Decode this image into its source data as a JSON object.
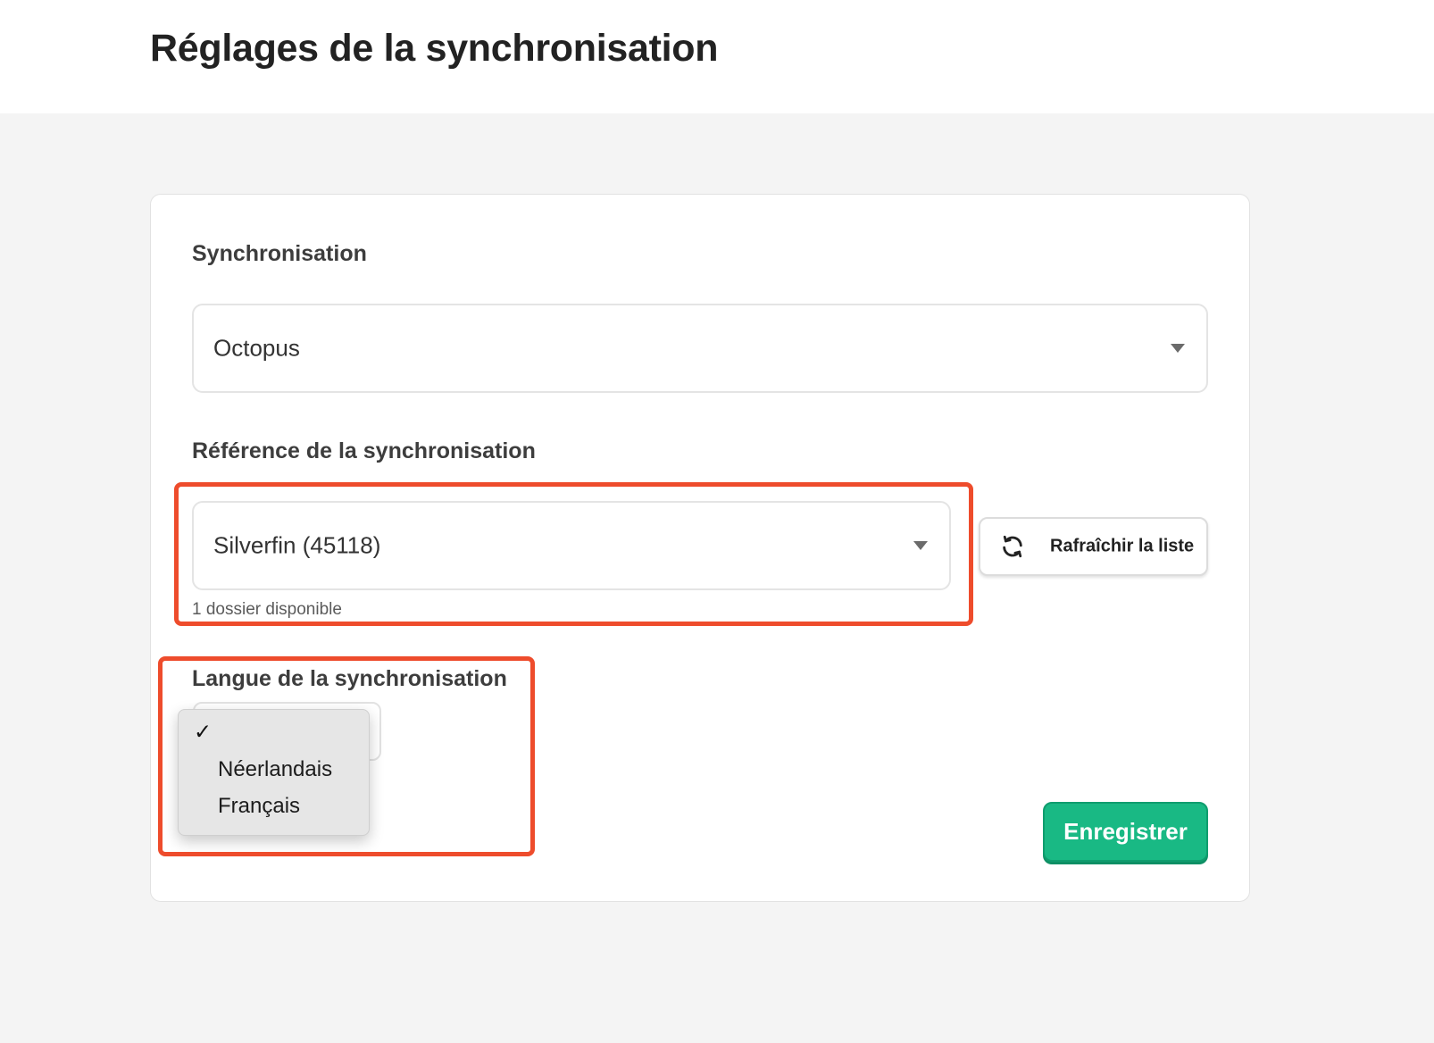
{
  "page": {
    "title": "Réglages de la synchronisation"
  },
  "sync": {
    "label": "Synchronisation",
    "value": "Octopus"
  },
  "reference": {
    "label": "Référence de la synchronisation",
    "value": "Silverfin (45118)",
    "helper": "1 dossier disponible",
    "refresh_label": "Rafraîchir la liste",
    "refresh_icon": "refresh-icon"
  },
  "language": {
    "label": "Langue de la synchronisation",
    "options": [
      {
        "label": "",
        "checked": true
      },
      {
        "label": "Néerlandais",
        "checked": false
      },
      {
        "label": "Français",
        "checked": false
      }
    ],
    "check_glyph": "✓"
  },
  "actions": {
    "save_label": "Enregistrer"
  },
  "colors": {
    "accent": "#19b984",
    "highlight": "#ee4c2c",
    "background": "#f4f4f4"
  }
}
